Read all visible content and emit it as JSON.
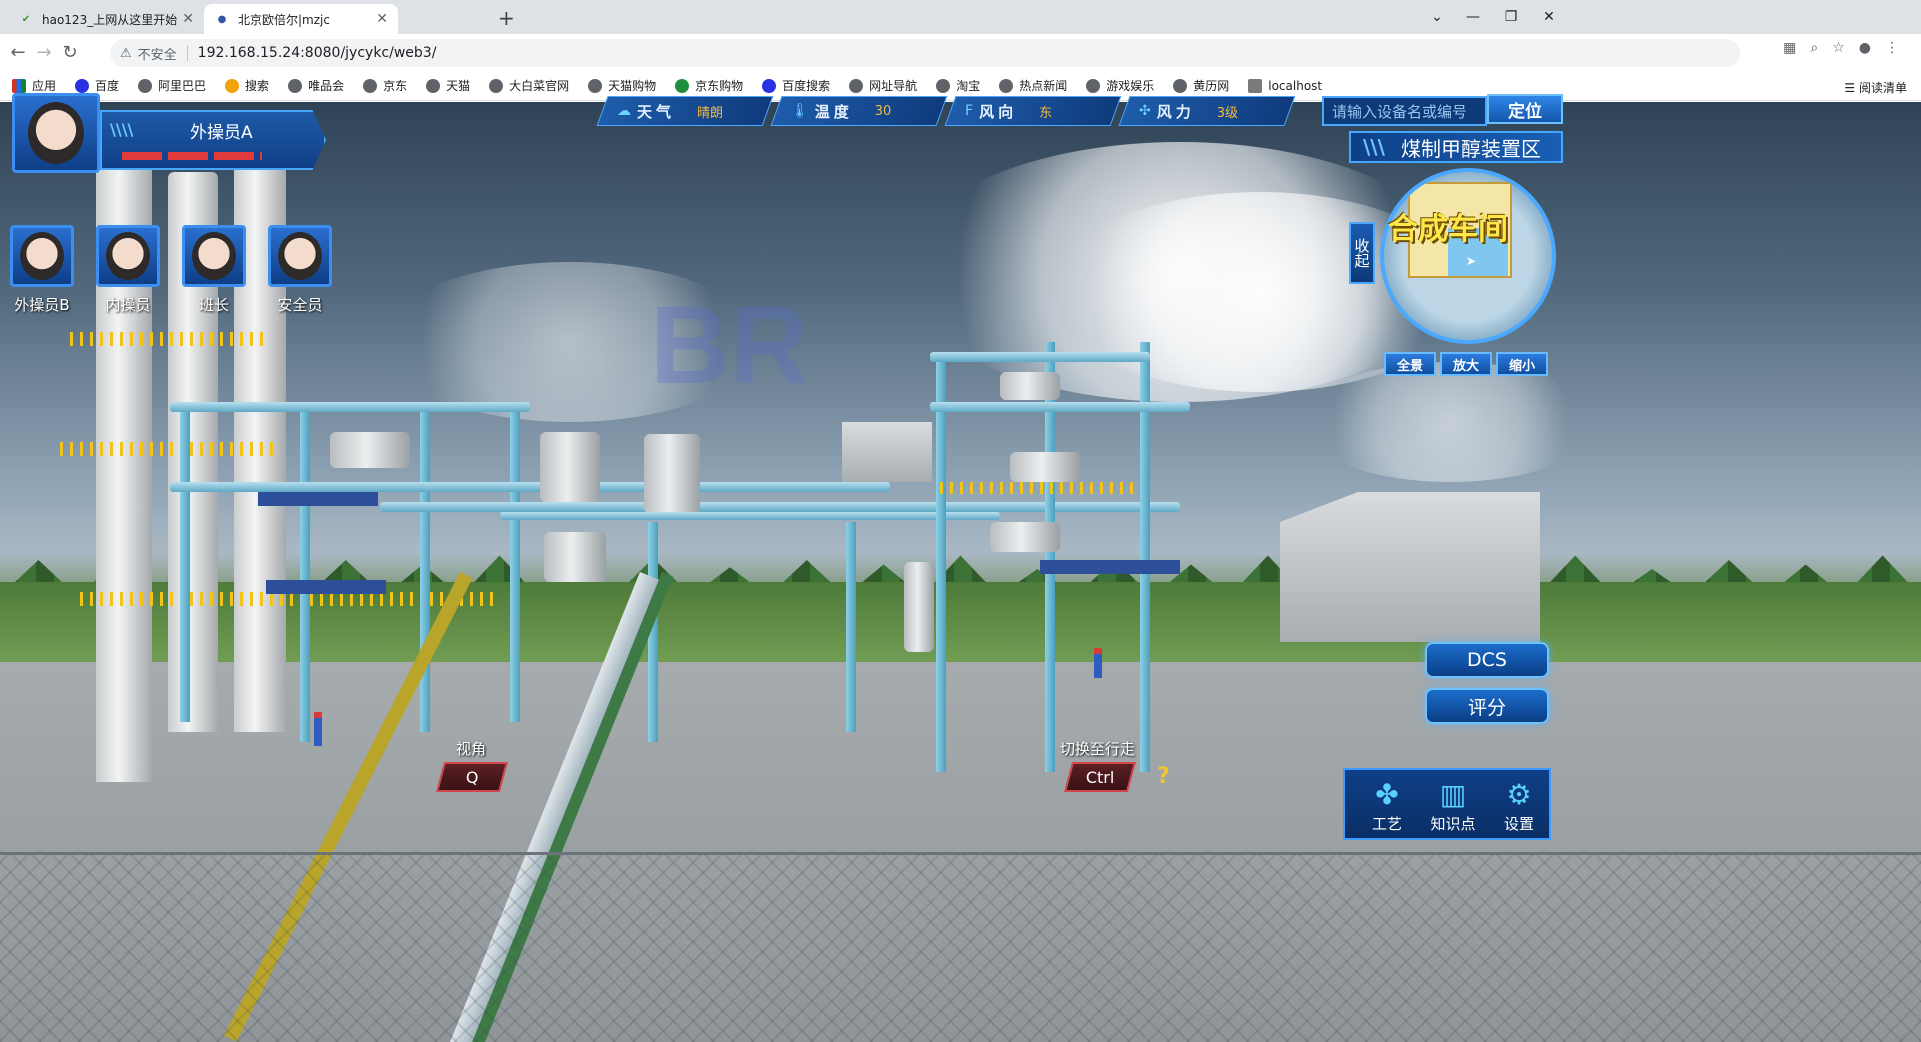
{
  "browser": {
    "tabs": [
      {
        "title": "hao123_上网从这里开始",
        "active": false,
        "favicon": "hao123-icon"
      },
      {
        "title": "北京欧倍尔|mzjc",
        "active": true,
        "favicon": "obr-icon"
      }
    ],
    "new_tab_label": "+",
    "address": {
      "security_label": "不安全",
      "url": "192.168.15.24:8080/jycykc/web3/"
    },
    "bookmarks": [
      "应用",
      "百度",
      "阿里巴巴",
      "搜索",
      "唯品会",
      "京东",
      "天猫",
      "大白菜官网",
      "天猫购物",
      "京东购物",
      "百度搜索",
      "网址导航",
      "淘宝",
      "热点新闻",
      "游戏娱乐",
      "黄历网",
      "localhost"
    ],
    "reading_list": "阅读清单"
  },
  "game": {
    "player": {
      "name": "外操员A"
    },
    "team": [
      {
        "name": "外操员B"
      },
      {
        "name": "内操员"
      },
      {
        "name": "班长"
      },
      {
        "name": "安全员"
      }
    ],
    "weather": [
      {
        "label": "天气",
        "value": "晴朗",
        "icon": "sun-cloud-icon"
      },
      {
        "label": "温度",
        "value": "30",
        "icon": "thermometer-icon"
      },
      {
        "label": "风向",
        "value": "东",
        "icon": "wind-direction-icon"
      },
      {
        "label": "风力",
        "value": "3级",
        "icon": "wind-force-icon"
      }
    ],
    "search": {
      "placeholder": "请输入设备名或编号",
      "button": "定位"
    },
    "area_title": "煤制甲醇装置区",
    "minimap": {
      "collapse_label": "收起",
      "zone_label": "合成车间",
      "buttons": [
        "全景",
        "放大",
        "缩小"
      ]
    },
    "side_buttons": {
      "dcs": "DCS",
      "score": "评分"
    },
    "controls": {
      "view": {
        "label": "视角",
        "key": "Q"
      },
      "walk": {
        "label": "切换至行走",
        "key": "Ctrl"
      },
      "help": "?"
    },
    "bottom_menu": [
      {
        "label": "工艺",
        "icon": "process-fan-icon"
      },
      {
        "label": "知识点",
        "icon": "knowledge-book-icon"
      },
      {
        "label": "设置",
        "icon": "settings-gear-icon"
      }
    ],
    "watermark": "BR"
  }
}
